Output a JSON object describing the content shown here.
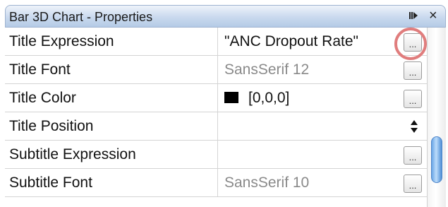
{
  "window": {
    "title": "Bar 3D Chart - Properties",
    "pin_icon": "pin-icon",
    "close_icon": "close-icon",
    "close_label": "×"
  },
  "properties": [
    {
      "name": "Title Expression",
      "value": "\"ANC Dropout Rate\"",
      "editor": "ellipsis"
    },
    {
      "name": "Title Font",
      "value": "SansSerif 12",
      "editor": "ellipsis",
      "value_style": "dim"
    },
    {
      "name": "Title Color",
      "value": "[0,0,0]",
      "swatch_color": "#000000",
      "editor": "ellipsis"
    },
    {
      "name": "Title Position",
      "value": "",
      "editor": "spinner"
    },
    {
      "name": "Subtitle Expression",
      "value": "",
      "editor": "ellipsis"
    },
    {
      "name": "Subtitle Font",
      "value": "SansSerif 10",
      "editor": "ellipsis",
      "value_style": "dim"
    }
  ],
  "ellipsis_label": "...",
  "colors": {
    "highlight": "#e07d7d",
    "scroll_thumb": "#6aa6e6"
  }
}
